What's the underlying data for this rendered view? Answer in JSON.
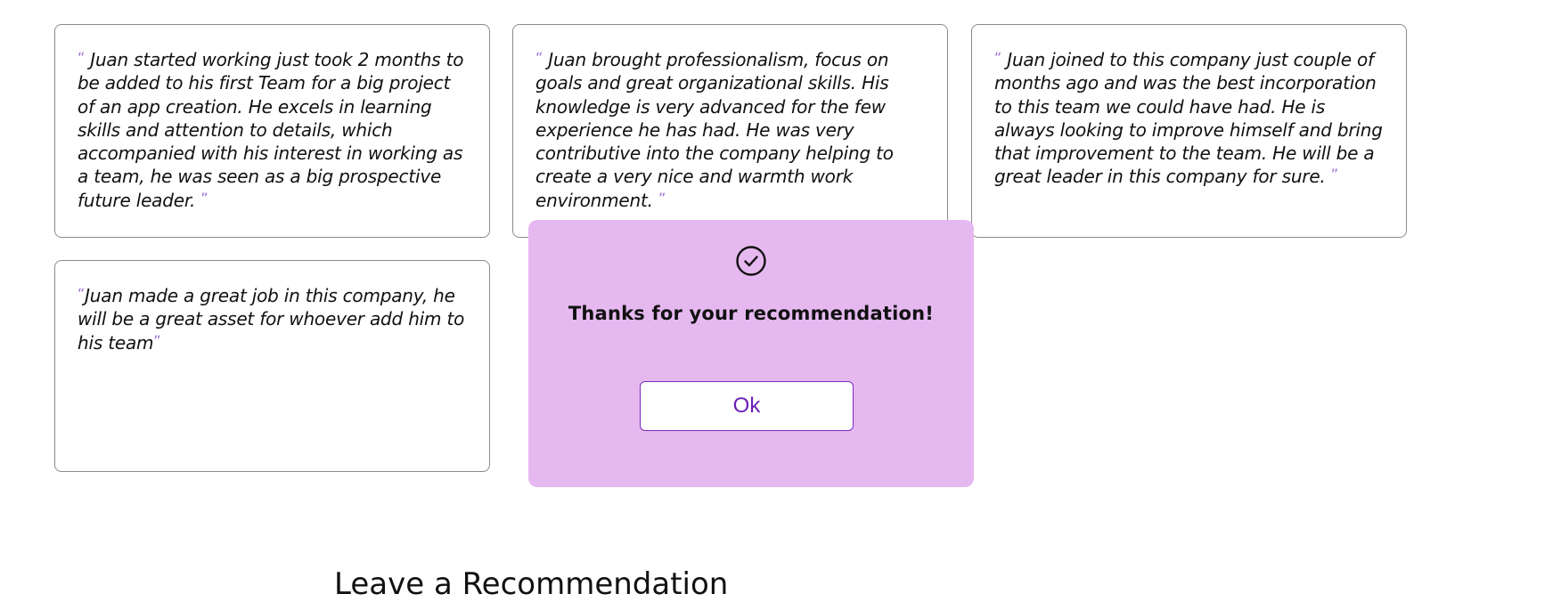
{
  "recommendations": [
    {
      "open_quote": "“",
      "text": " Juan started working just took 2 months to be added to his first Team for a big project of an app creation. He excels in learning skills and attention to details, which accompanied with his interest in working as a team, he was seen as a big prospective future leader. ",
      "close_quote": "”"
    },
    {
      "open_quote": "“",
      "text": " Juan brought professionalism, focus on goals and great organizational skills. His knowledge is very advanced for the few experience he has had. He was very contributive into the company helping to create a very nice and warmth work environment. ",
      "close_quote": "”"
    },
    {
      "open_quote": "“",
      "text": " Juan joined to this company just couple of months ago and was the best incorporation to this team we could have had. He is always looking to improve himself and bring that improvement to the team. He will be a great leader in this company for sure. ",
      "close_quote": "”"
    },
    {
      "open_quote": "“",
      "text": "Juan made a great job in this company, he will be a great asset for whoever add him to his team",
      "close_quote": "”"
    }
  ],
  "modal": {
    "icon": "check-circle-icon",
    "message": "Thanks for your recommendation!",
    "ok_label": "Ok"
  },
  "section": {
    "heading": "Leave a Recommendation"
  },
  "colors": {
    "modal_background": "#e6b8f0",
    "accent": "#7a2dbf",
    "quote_mark": "#9b6fd6",
    "card_border": "#8a8a8a"
  }
}
